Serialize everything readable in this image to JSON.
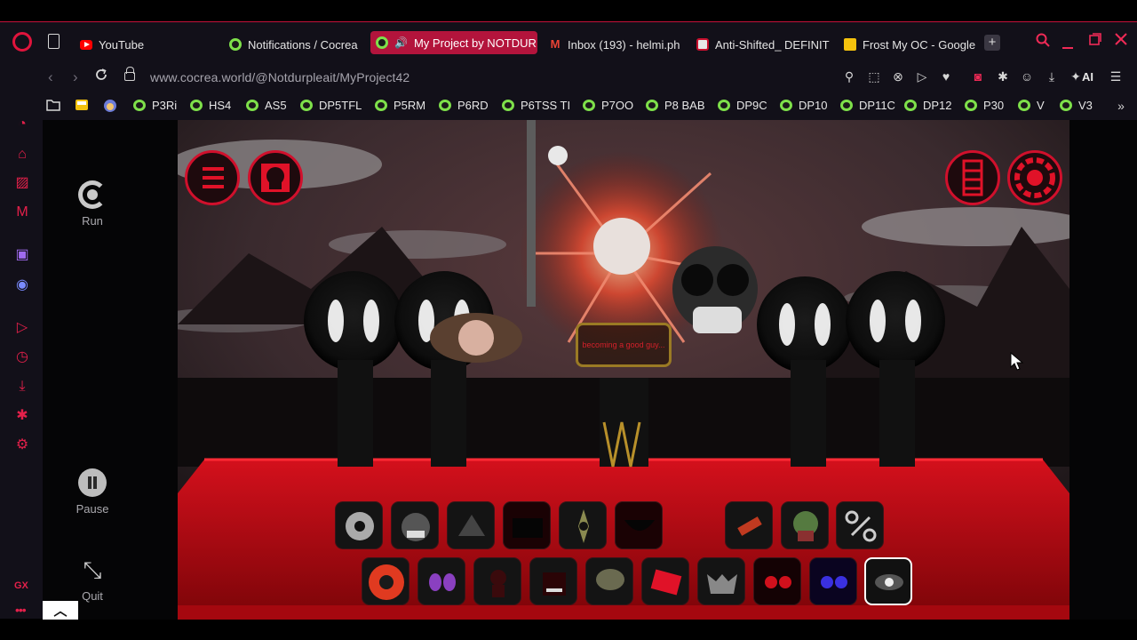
{
  "browser": {
    "tabs": [
      {
        "label": "YouTube",
        "fav": "youtube-icon"
      },
      {
        "label": "Notifications / Cocrea",
        "fav": "cocrea-icon"
      },
      {
        "label": "My Project by NOTDUR",
        "fav": "cocrea-icon",
        "active": true
      },
      {
        "label": "Inbox (193) - helmi.ph",
        "fav": "gmail-icon"
      },
      {
        "label": "Anti-Shifted_ DEFINIT",
        "fav": "anti-icon"
      },
      {
        "label": "Frost My OC - Google",
        "fav": "slides-icon"
      }
    ],
    "new_tab": "+",
    "url": "www.cocrea.world/@Notdurpleait/MyProject42",
    "ai_label": "AI",
    "bookmarks": [
      "P3Ri",
      "HS4",
      "AS5",
      "DP5TFL",
      "P5RM",
      "P6RD",
      "P6TSS TI",
      "P7OO",
      "P8 BAB",
      "DP9C",
      "DP10",
      "DP11C",
      "DP12",
      "P30",
      "V",
      "V3"
    ],
    "accent": "#e0143c",
    "sidebar_brand": "GX"
  },
  "app": {
    "run_label": "Run",
    "pause_label": "Pause",
    "quit_label": "Quit",
    "lyric_text": "becoming a good guy...",
    "colors": {
      "stage_red": "#c8101c",
      "frame_red": "#d0102c"
    }
  }
}
